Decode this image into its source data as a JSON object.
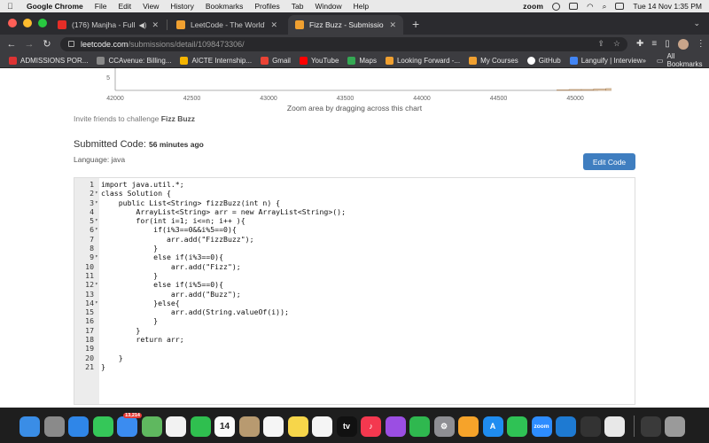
{
  "menubar": {
    "app_name": "Google Chrome",
    "items": [
      "File",
      "Edit",
      "View",
      "History",
      "Bookmarks",
      "Profiles",
      "Tab",
      "Window",
      "Help"
    ],
    "zoom_label": "zoom",
    "datetime": "Tue 14 Nov  1:35 PM"
  },
  "tabs": [
    {
      "title": "(176) Manjha - Full Video",
      "favicon_color": "#e52d27",
      "active": false
    },
    {
      "title": "LeetCode - The World's Leadi",
      "favicon_color": "#f0a030",
      "active": false
    },
    {
      "title": "Fizz Buzz - Submission Detail",
      "favicon_color": "#f0a030",
      "active": true
    }
  ],
  "address": {
    "host": "leetcode.com",
    "path": "/submissions/detail/1098473306/"
  },
  "bookmarks": [
    {
      "label": "ADMISSIONS POR...",
      "color": "#d33"
    },
    {
      "label": "CCAvenue: Billing...",
      "color": "#888"
    },
    {
      "label": "AICTE Internship...",
      "color": "#f4b400"
    },
    {
      "label": "Gmail",
      "color": "#ea4335"
    },
    {
      "label": "YouTube",
      "color": "#ff0000"
    },
    {
      "label": "Maps",
      "color": "#34a853"
    },
    {
      "label": "Looking Forward -...",
      "color": "#f0a030"
    },
    {
      "label": "My Courses",
      "color": "#f0a030"
    },
    {
      "label": "GitHub",
      "color": "#ffffff"
    },
    {
      "label": "Languify | Interview",
      "color": "#4285f4"
    }
  ],
  "bookmarks_more": "»",
  "bookmarks_all": "All Bookmarks",
  "chart_data": {
    "type": "bar",
    "x_ticks": [
      "42000",
      "42500",
      "43000",
      "43500",
      "44000",
      "44500",
      "45000"
    ],
    "y_tick_visible": "5",
    "bar_color": "#e9d3b6",
    "bar_stroke": "#a8815a",
    "bins_start": 42000,
    "bins_width": 80,
    "values": [
      0,
      0,
      0,
      0,
      0,
      0,
      0,
      0,
      0,
      0,
      0,
      0,
      0,
      0,
      0,
      0,
      0,
      0,
      0,
      0,
      0,
      0,
      0,
      0,
      0,
      0,
      0,
      0,
      0,
      0,
      0,
      0,
      0,
      0,
      0,
      0,
      0.1,
      0.2,
      0.2,
      0.3,
      0.4,
      0.5,
      0.7,
      0.9,
      1.1,
      1.4,
      1.8,
      2.3,
      3.0,
      3.6,
      4.8,
      6.0,
      6.6,
      6.6,
      6.6,
      6.6,
      6.6,
      6.6,
      6.6,
      6.6
    ]
  },
  "chart_hint": "Zoom area by dragging across this chart",
  "invite": {
    "prefix": "Invite friends to challenge",
    "problem": "Fizz Buzz"
  },
  "submission": {
    "heading": "Submitted Code:",
    "time": "56 minutes ago",
    "language": "Language: java",
    "edit_label": "Edit Code"
  },
  "code_lines": [
    {
      "n": "1",
      "fold": "",
      "text": "import java.util.*;"
    },
    {
      "n": "2",
      "fold": "▾",
      "text": "class Solution {"
    },
    {
      "n": "3",
      "fold": "▾",
      "text": "    public List<String> fizzBuzz(int n) {"
    },
    {
      "n": "4",
      "fold": "",
      "text": "        ArrayList<String> arr = new ArrayList<String>();"
    },
    {
      "n": "5",
      "fold": "▾",
      "text": "        for(int i=1; i<=n; i++ ){"
    },
    {
      "n": "6",
      "fold": "▾",
      "text": "            if(i%3==0&&i%5==0){"
    },
    {
      "n": "7",
      "fold": "",
      "text": "               arr.add(\"FizzBuzz\");"
    },
    {
      "n": "8",
      "fold": "",
      "text": "            }"
    },
    {
      "n": "9",
      "fold": "▾",
      "text": "            else if(i%3==0){"
    },
    {
      "n": "10",
      "fold": "",
      "text": "                arr.add(\"Fizz\");"
    },
    {
      "n": "11",
      "fold": "",
      "text": "            }"
    },
    {
      "n": "12",
      "fold": "▾",
      "text": "            else if(i%5==0){"
    },
    {
      "n": "13",
      "fold": "",
      "text": "                arr.add(\"Buzz\");"
    },
    {
      "n": "14",
      "fold": "▾",
      "text": "            }else{"
    },
    {
      "n": "15",
      "fold": "",
      "text": "                arr.add(String.valueOf(i));"
    },
    {
      "n": "16",
      "fold": "",
      "text": "            }"
    },
    {
      "n": "17",
      "fold": "",
      "text": "        }"
    },
    {
      "n": "18",
      "fold": "",
      "text": "        return arr;"
    },
    {
      "n": "19",
      "fold": "",
      "text": ""
    },
    {
      "n": "20",
      "fold": "",
      "text": "    }"
    },
    {
      "n": "21",
      "fold": "",
      "text": "}"
    }
  ],
  "dock": [
    {
      "name": "finder",
      "color": "#3a8de6",
      "label": ""
    },
    {
      "name": "launchpad",
      "color": "#8a8a8a",
      "label": ""
    },
    {
      "name": "safari",
      "color": "#2f86e8",
      "label": ""
    },
    {
      "name": "messages",
      "color": "#35c759",
      "label": ""
    },
    {
      "name": "mail",
      "color": "#3b8cf0",
      "label": "",
      "badge": "13,214"
    },
    {
      "name": "maps",
      "color": "#5fb85f",
      "label": ""
    },
    {
      "name": "photos",
      "color": "#f2f2f2",
      "label": ""
    },
    {
      "name": "facetime",
      "color": "#2fbf4f",
      "label": ""
    },
    {
      "name": "calendar",
      "color": "#fafafa",
      "label": "14"
    },
    {
      "name": "contacts",
      "color": "#b89a70",
      "label": ""
    },
    {
      "name": "reminders",
      "color": "#f5f5f5",
      "label": ""
    },
    {
      "name": "notes",
      "color": "#f7d64a",
      "label": ""
    },
    {
      "name": "freeform",
      "color": "#f5f5f5",
      "label": ""
    },
    {
      "name": "tv",
      "color": "#111111",
      "label": "tv"
    },
    {
      "name": "music",
      "color": "#f4384f",
      "label": "♪"
    },
    {
      "name": "podcasts",
      "color": "#9b4ee3",
      "label": ""
    },
    {
      "name": "numbers",
      "color": "#2fb84f",
      "label": ""
    },
    {
      "name": "system-settings",
      "color": "#8e8e93",
      "label": "⚙"
    },
    {
      "name": "pages",
      "color": "#f6a32a",
      "label": ""
    },
    {
      "name": "app-store",
      "color": "#1f8cf0",
      "label": "A"
    },
    {
      "name": "whatsapp",
      "color": "#2fc255",
      "label": ""
    },
    {
      "name": "zoom",
      "color": "#2d8cff",
      "label": "zoom"
    },
    {
      "name": "vscode",
      "color": "#1e7ad2",
      "label": ""
    },
    {
      "name": "brush-app",
      "color": "#333333",
      "label": ""
    },
    {
      "name": "chrome",
      "color": "#e8e8e8",
      "label": ""
    },
    {
      "name": "downloads",
      "color": "#3a3a3a",
      "label": ""
    },
    {
      "name": "trash",
      "color": "#9a9a9a",
      "label": ""
    }
  ]
}
